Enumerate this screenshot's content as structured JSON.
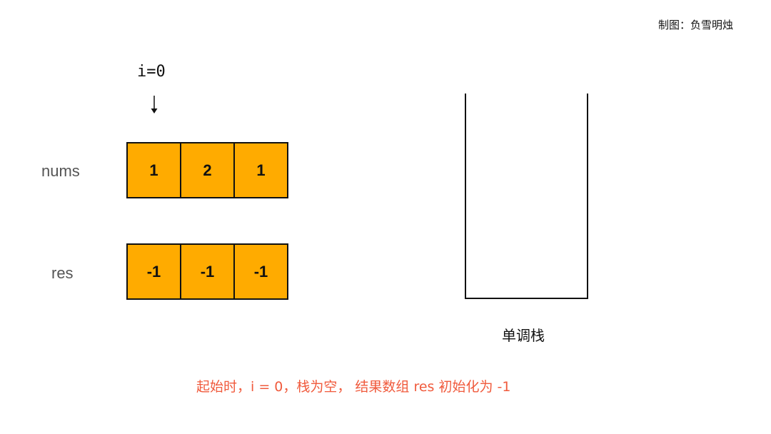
{
  "credit": "制图：负雪明烛",
  "pointer": {
    "label": "i=0",
    "index": 0
  },
  "nums": {
    "label": "nums",
    "cells": [
      "1",
      "2",
      "1"
    ]
  },
  "res": {
    "label": "res",
    "cells": [
      "-1",
      "-1",
      "-1"
    ]
  },
  "stack": {
    "label": "单调栈",
    "items": []
  },
  "caption": "起始时，i = 0，栈为空， 结果数组 res 初始化为 -1",
  "colors": {
    "cell_fill": "#FFAB00",
    "caption": "#F05A3C",
    "row_label": "#555555"
  }
}
